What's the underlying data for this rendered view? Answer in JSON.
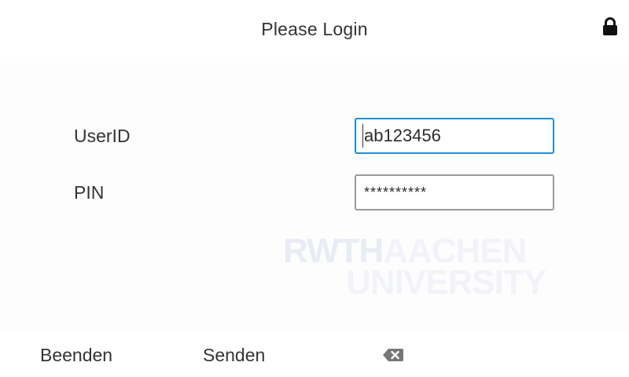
{
  "header": {
    "title": "Please Login",
    "lock_icon": "lock-icon"
  },
  "form": {
    "userid_label": "UserID",
    "userid_value": "ab123456",
    "pin_label": "PIN",
    "pin_value": "**********"
  },
  "watermark": {
    "line1_a": "RWTH",
    "line1_b": "AACHEN",
    "line2": "UNIVERSITY"
  },
  "bottom": {
    "beenden_label": "Beenden",
    "senden_label": "Senden",
    "backspace_icon": "backspace-icon"
  },
  "colors": {
    "focus_border": "#1c8fd1",
    "input_border": "#9a9a9a",
    "text": "#333333"
  }
}
